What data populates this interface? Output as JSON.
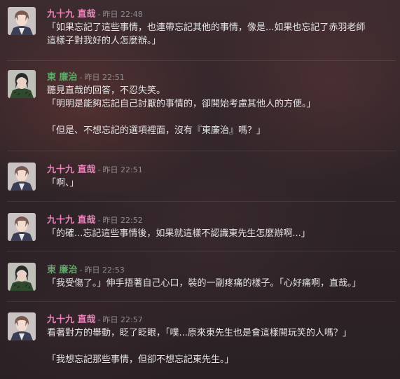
{
  "messages": [
    {
      "author": "九十九 直哉",
      "separator": "-",
      "timestamp": "昨日 22:48",
      "author_color": "#e783b9",
      "avatar": "naoya-avatar",
      "lines": [
        "「如果忘記了這些事情，也連帶忘記其他的事情，像是...如果也忘記了赤羽老師",
        "這樣子對我好的人怎麼辦。」"
      ]
    },
    {
      "author": "東 廉治",
      "separator": "-",
      "timestamp": "昨日 22:51",
      "author_color": "#5fa86a",
      "avatar": "renji-avatar",
      "lines": [
        "聽見直哉的回答，不忍失笑。",
        "「明明是能夠忘記自己討厭的事情的，卻開始考慮其他人的方便。」",
        "",
        "「但是、不想忘記的選項裡面，沒有『東廉治』嗎？」"
      ]
    },
    {
      "author": "九十九 直哉",
      "separator": "-",
      "timestamp": "昨日 22:51",
      "author_color": "#e783b9",
      "avatar": "naoya-avatar",
      "lines": [
        "「啊、」"
      ]
    },
    {
      "author": "九十九 直哉",
      "separator": "-",
      "timestamp": "昨日 22:52",
      "author_color": "#e783b9",
      "avatar": "naoya-avatar",
      "lines": [
        "「的確...忘記這些事情後，如果就這樣不認識東先生怎麼辦啊...」"
      ]
    },
    {
      "author": "東 廉治",
      "separator": "-",
      "timestamp": "昨日 22:53",
      "author_color": "#5fa86a",
      "avatar": "renji-avatar",
      "lines": [
        "「我受傷了。」伸手捂著自己心口，裝的一副疼痛的樣子。「心好痛啊，直哉。」"
      ]
    },
    {
      "author": "九十九 直哉",
      "separator": "-",
      "timestamp": "昨日 22:57",
      "author_color": "#e783b9",
      "avatar": "naoya-avatar",
      "lines": [
        "看著對方的舉動，眨了眨眼，「噗...原來東先生也是會這樣開玩笑的人嗎？」",
        "",
        "「我想忘記那些事情，但卻不想忘記東先生。」"
      ]
    }
  ]
}
